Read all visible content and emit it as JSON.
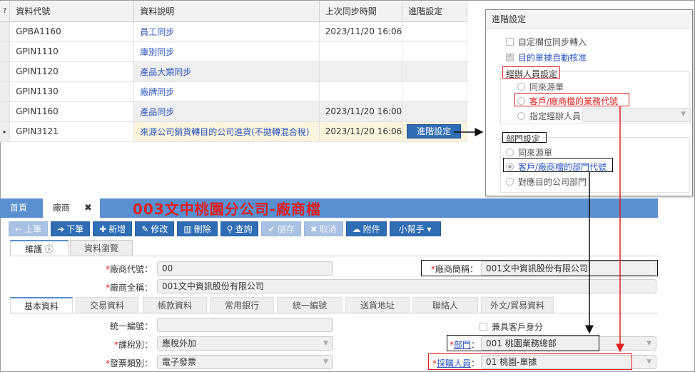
{
  "table": {
    "header_icon": "?",
    "columns": [
      "資料代號",
      "資料說明",
      "上次同步時間",
      "進階設定"
    ],
    "rows": [
      {
        "code": "GPBA1160",
        "desc": "員工同步",
        "time": "2023/11/20 16:06",
        "adv": ""
      },
      {
        "code": "GPIN1110",
        "desc": "庫別同步",
        "time": "",
        "adv": ""
      },
      {
        "code": "GPIN1120",
        "desc": "產品大類同步",
        "time": "",
        "adv": ""
      },
      {
        "code": "GPIN1130",
        "desc": "廠牌同步",
        "time": "",
        "adv": ""
      },
      {
        "code": "GPIN1160",
        "desc": "產品同步",
        "time": "2023/11/20 16:00",
        "adv": ""
      },
      {
        "code": "GPIN3121",
        "desc": "來源公司銷貨轉目的公司進貨(不拋轉混合稅)",
        "time": "2023/11/20 16:06",
        "adv": "進階設定"
      }
    ],
    "selected_marker": "▸"
  },
  "popup": {
    "title": "進階設定",
    "opt1": "自定欄位同步轉入",
    "opt2": "目的單據自動核准",
    "section1": "經辦人員設定",
    "s1_r1": "同來源單",
    "s1_r2": "客戶/廠商檔的業務代號",
    "s1_r3": "指定經辦人員",
    "section2": "部門設定",
    "s2_r1": "同來源單",
    "s2_r2": "客戶/廠商檔的部門代號",
    "s2_r3": "對應目的公司部門"
  },
  "tabs": {
    "home": "首頁",
    "vendor": "廠商",
    "close": "✖"
  },
  "company_title": "003文中桃園分公司-廠商檔",
  "toolbar": {
    "prev": "上筆",
    "next": "下筆",
    "add": "新增",
    "edit": "修改",
    "delete": "刪除",
    "query": "查詢",
    "save": "儲存",
    "cancel": "取消",
    "attach": "附件",
    "helper": "小幫手"
  },
  "subtabs": {
    "maintain": "維護",
    "browse": "資料瀏覽"
  },
  "form": {
    "vendor_code_label": "廠商代號：",
    "vendor_code": "00",
    "short_name_label": "廠商簡稱：",
    "short_name": "001文中資訊股份有限公司",
    "full_name_label": "廠商全稱：",
    "full_name": "001文中資訊股份有限公司",
    "tax_id_label": "統一編號：",
    "tax_id": "",
    "also_customer": "兼具客戶身分",
    "tax_type_label": "課稅別：",
    "tax_type": "應稅外加",
    "dept_label": "部門",
    "dept": "001 桃園業務總部",
    "invoice_type_label": "發票類別：",
    "invoice_type": "電子發票",
    "buyer_label": "採購人員",
    "buyer": "01 桃園-單據",
    "colon": "："
  },
  "form_tabs": [
    "基本資料",
    "交易資料",
    "帳款資料",
    "常用銀行",
    "統一編號",
    "送貨地址",
    "聯絡人",
    "外文/貿易資料"
  ],
  "colors": {
    "accent": "#5a8fd0",
    "button": "#2f6db5",
    "highlight": "#e02020",
    "link": "#2a53c1"
  }
}
